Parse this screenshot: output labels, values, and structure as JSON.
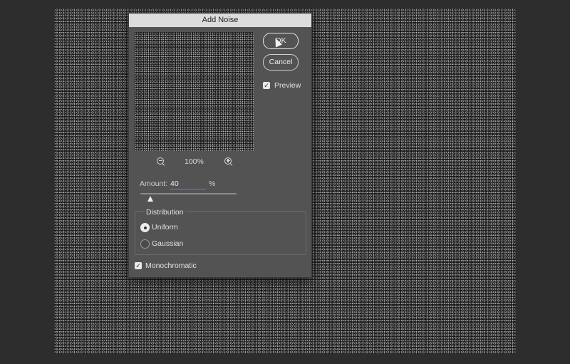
{
  "dialog": {
    "title": "Add Noise",
    "ok_label": "OK",
    "cancel_label": "Cancel",
    "preview_label": "Preview",
    "preview_checked": true,
    "zoom_level": "100%",
    "amount_label": "Amount:",
    "amount_value": "40",
    "amount_unit": "%",
    "amount_slider_fraction": 0.1,
    "distribution_label": "Distribution",
    "distribution_options": [
      "Uniform",
      "Gaussian"
    ],
    "distribution_selected": "Uniform",
    "monochromatic_label": "Monochromatic",
    "monochromatic_checked": true
  },
  "icons": {
    "zoom_out": "zoom-out-icon",
    "zoom_in": "zoom-in-icon",
    "checkmark": "✓"
  }
}
